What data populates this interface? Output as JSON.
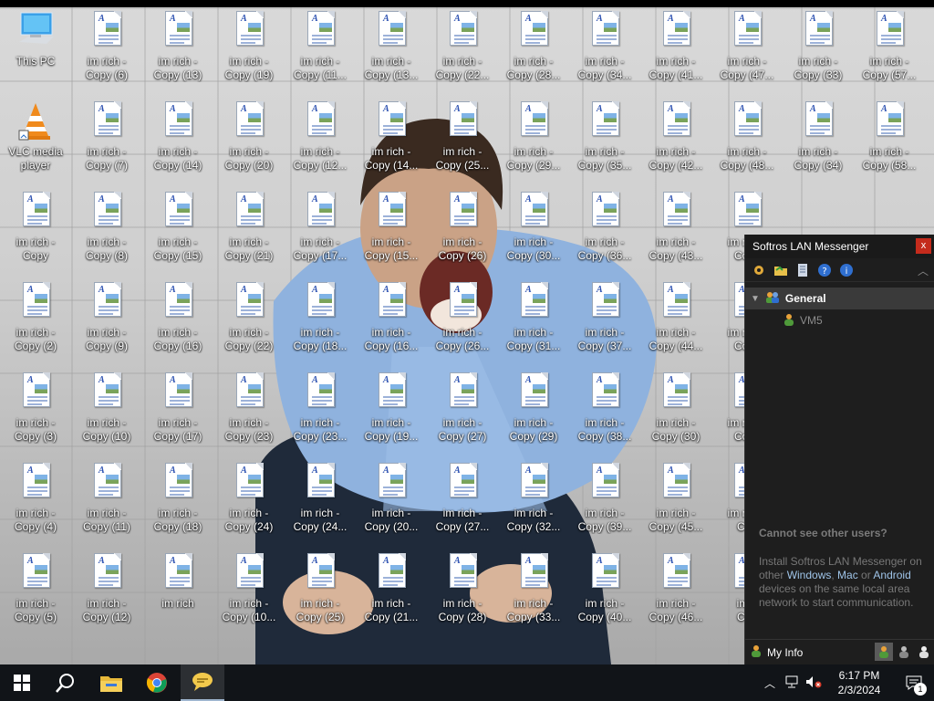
{
  "desktop": {
    "icons": [
      {
        "label": "This PC",
        "type": "pc"
      },
      {
        "label": "im rich -\nCopy (6)",
        "type": "doc"
      },
      {
        "label": "im rich -\nCopy (13)",
        "type": "doc"
      },
      {
        "label": "im rich -\nCopy (19)",
        "type": "doc"
      },
      {
        "label": "im rich -\nCopy (11...",
        "type": "doc"
      },
      {
        "label": "im rich -\nCopy (13...",
        "type": "doc"
      },
      {
        "label": "im rich -\nCopy (22...",
        "type": "doc"
      },
      {
        "label": "im rich -\nCopy (28...",
        "type": "doc"
      },
      {
        "label": "im rich -\nCopy (34...",
        "type": "doc"
      },
      {
        "label": "im rich -\nCopy (41...",
        "type": "doc"
      },
      {
        "label": "im rich -\nCopy (47...",
        "type": "doc"
      },
      {
        "label": "im rich -\nCopy (33)",
        "type": "doc"
      },
      {
        "label": "im rich -\nCopy (57...",
        "type": "doc"
      },
      {
        "label": "VLC media\nplayer",
        "type": "vlc"
      },
      {
        "label": "im rich -\nCopy (7)",
        "type": "doc"
      },
      {
        "label": "im rich -\nCopy (14)",
        "type": "doc"
      },
      {
        "label": "im rich -\nCopy (20)",
        "type": "doc"
      },
      {
        "label": "im rich -\nCopy (12...",
        "type": "doc"
      },
      {
        "label": "im rich -\nCopy (14...",
        "type": "doc"
      },
      {
        "label": "im rich -\nCopy (25...",
        "type": "doc"
      },
      {
        "label": "im rich -\nCopy (29...",
        "type": "doc"
      },
      {
        "label": "im rich -\nCopy (35...",
        "type": "doc"
      },
      {
        "label": "im rich -\nCopy (42...",
        "type": "doc"
      },
      {
        "label": "im rich -\nCopy (48...",
        "type": "doc"
      },
      {
        "label": "im rich -\nCopy (34)",
        "type": "doc"
      },
      {
        "label": "im rich -\nCopy (58...",
        "type": "doc"
      },
      {
        "label": "im rich -\nCopy",
        "type": "doc"
      },
      {
        "label": "im rich -\nCopy (8)",
        "type": "doc"
      },
      {
        "label": "im rich -\nCopy (15)",
        "type": "doc"
      },
      {
        "label": "im rich -\nCopy (21)",
        "type": "doc"
      },
      {
        "label": "im rich -\nCopy (17...",
        "type": "doc"
      },
      {
        "label": "im rich -\nCopy (15...",
        "type": "doc"
      },
      {
        "label": "im rich -\nCopy (26)",
        "type": "doc"
      },
      {
        "label": "im rich -\nCopy (30...",
        "type": "doc"
      },
      {
        "label": "im rich -\nCopy (36...",
        "type": "doc"
      },
      {
        "label": "im rich -\nCopy (43...",
        "type": "doc"
      },
      {
        "label": "im rich -\nCopy",
        "type": "doc"
      },
      {
        "label": "im rich -\nCopy (2)",
        "type": "doc"
      },
      {
        "label": "im rich -\nCopy (9)",
        "type": "doc"
      },
      {
        "label": "im rich -\nCopy (16)",
        "type": "doc"
      },
      {
        "label": "im rich -\nCopy (22)",
        "type": "doc"
      },
      {
        "label": "im rich -\nCopy (18...",
        "type": "doc"
      },
      {
        "label": "im rich -\nCopy (16...",
        "type": "doc"
      },
      {
        "label": "im rich -\nCopy (26...",
        "type": "doc"
      },
      {
        "label": "im rich -\nCopy (31...",
        "type": "doc"
      },
      {
        "label": "im rich -\nCopy (37...",
        "type": "doc"
      },
      {
        "label": "im rich -\nCopy (44...",
        "type": "doc"
      },
      {
        "label": "im rich -\nCopy",
        "type": "doc"
      },
      {
        "label": "im rich -\nCopy (3)",
        "type": "doc"
      },
      {
        "label": "im rich -\nCopy (10)",
        "type": "doc"
      },
      {
        "label": "im rich -\nCopy (17)",
        "type": "doc"
      },
      {
        "label": "im rich -\nCopy (23)",
        "type": "doc"
      },
      {
        "label": "im rich -\nCopy (23...",
        "type": "doc"
      },
      {
        "label": "im rich -\nCopy (19...",
        "type": "doc"
      },
      {
        "label": "im rich -\nCopy (27)",
        "type": "doc"
      },
      {
        "label": "im rich -\nCopy (29)",
        "type": "doc"
      },
      {
        "label": "im rich -\nCopy (38...",
        "type": "doc"
      },
      {
        "label": "im rich -\nCopy (30)",
        "type": "doc"
      },
      {
        "label": "im rich -\nCopy",
        "type": "doc"
      },
      {
        "label": "im rich -\nCopy (4)",
        "type": "doc"
      },
      {
        "label": "im rich -\nCopy (11)",
        "type": "doc"
      },
      {
        "label": "im rich -\nCopy (18)",
        "type": "doc"
      },
      {
        "label": "im rich -\nCopy (24)",
        "type": "doc"
      },
      {
        "label": "im rich -\nCopy (24...",
        "type": "doc"
      },
      {
        "label": "im rich -\nCopy (20...",
        "type": "doc"
      },
      {
        "label": "im rich -\nCopy (27...",
        "type": "doc"
      },
      {
        "label": "im rich -\nCopy (32...",
        "type": "doc"
      },
      {
        "label": "im rich -\nCopy (39...",
        "type": "doc"
      },
      {
        "label": "im rich -\nCopy (45...",
        "type": "doc"
      },
      {
        "label": "im rich -\nCop",
        "type": "doc"
      },
      {
        "label": "im rich -\nCopy (5)",
        "type": "doc"
      },
      {
        "label": "im rich -\nCopy (12)",
        "type": "doc"
      },
      {
        "label": "im rich",
        "type": "doc"
      },
      {
        "label": "im rich -\nCopy (10...",
        "type": "doc"
      },
      {
        "label": "im rich -\nCopy (25)",
        "type": "doc"
      },
      {
        "label": "im rich -\nCopy (21...",
        "type": "doc"
      },
      {
        "label": "im rich -\nCopy (28)",
        "type": "doc"
      },
      {
        "label": "im rich -\nCopy (33...",
        "type": "doc"
      },
      {
        "label": "im rich -\nCopy (40...",
        "type": "doc"
      },
      {
        "label": "im rich -\nCopy (46...",
        "type": "doc"
      },
      {
        "label": "im ri\nCop",
        "type": "doc"
      }
    ]
  },
  "messenger": {
    "title": "Softros LAN Messenger",
    "close_label": "x",
    "toolbar": [
      "settings-icon",
      "folder-icon",
      "history-icon",
      "help-icon",
      "info-icon"
    ],
    "group_name": "General",
    "user_name": "VM5",
    "hint_title": "Cannot see other users?",
    "hint_text_1": "Install Softros LAN Messenger on other ",
    "hint_link_1": "Windows",
    "hint_text_2": ", ",
    "hint_link_2": "Mac",
    "hint_text_3": " or ",
    "hint_link_3": "Android",
    "hint_text_4": " devices on the same local area network to start communication.",
    "my_info_label": "My Info"
  },
  "taskbar": {
    "items": [
      "start-icon",
      "search-icon",
      "file-explorer-icon",
      "chrome-icon",
      "lan-messenger-icon"
    ],
    "time": "6:17 PM",
    "date": "2/3/2024",
    "notification_count": "1",
    "colors": {
      "background": "#111418",
      "accent": "#9fb6cf"
    }
  }
}
